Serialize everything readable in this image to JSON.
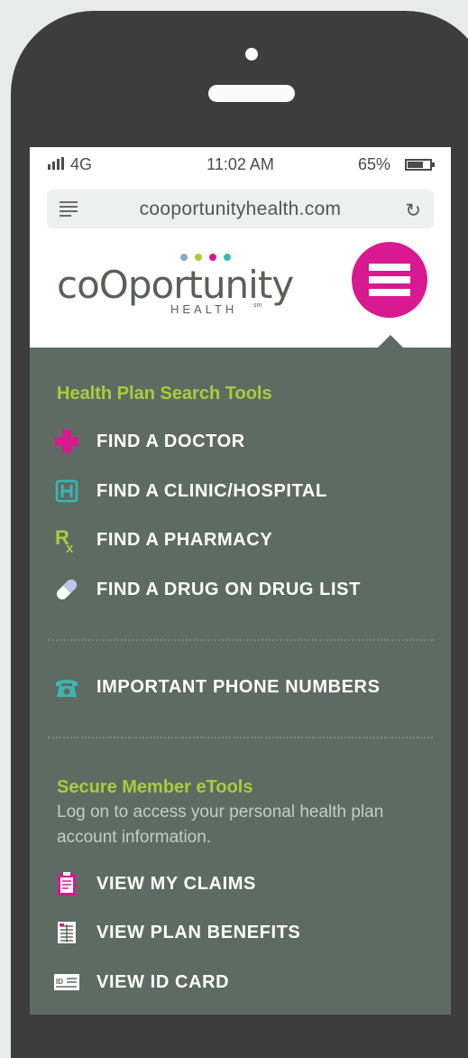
{
  "status_bar": {
    "network": "4G",
    "time": "11:02 AM",
    "battery": "65%"
  },
  "browser": {
    "url": "cooportunityhealth.com"
  },
  "header": {
    "logo_text": "coOportunity",
    "logo_subtext": "HEALTH",
    "logo_mark": "sm"
  },
  "menu": {
    "search_tools": {
      "title": "Health Plan Search Tools",
      "items": [
        {
          "label": "FIND A DOCTOR",
          "icon": "medical-cross-icon"
        },
        {
          "label": "FIND A CLINIC/HOSPITAL",
          "icon": "hospital-icon"
        },
        {
          "label": "FIND A PHARMACY",
          "icon": "rx-icon"
        },
        {
          "label": "FIND A DRUG ON DRUG LIST",
          "icon": "pill-icon"
        }
      ]
    },
    "phone_item": {
      "label": "IMPORTANT PHONE NUMBERS",
      "icon": "phone-icon"
    },
    "member_tools": {
      "title": "Secure Member eTools",
      "description": "Log on to access your personal health plan account information.",
      "items": [
        {
          "label": "VIEW MY CLAIMS",
          "icon": "clipboard-icon"
        },
        {
          "label": "VIEW PLAN BENEFITS",
          "icon": "benefits-doc-icon"
        },
        {
          "label": "VIEW ID CARD",
          "icon": "id-card-icon"
        }
      ]
    }
  },
  "colors": {
    "accent_magenta": "#d8198f",
    "accent_green": "#a8cd3c",
    "accent_teal": "#3bb7b3",
    "panel_bg": "#5e6b63",
    "logo_dots": [
      "#8fa8c8",
      "#a8cd3c",
      "#d8198f",
      "#3bb7b3"
    ]
  }
}
